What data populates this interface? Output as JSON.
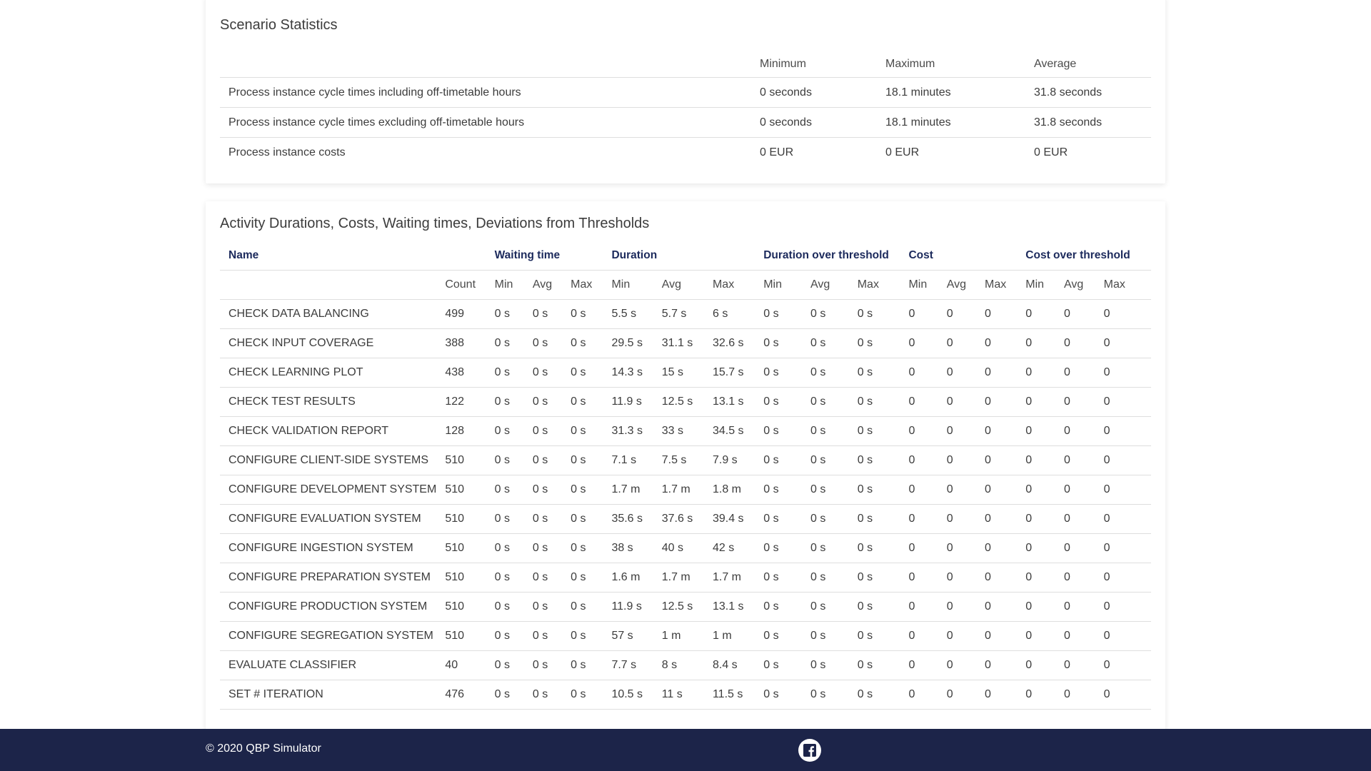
{
  "scenario": {
    "title": "Scenario Statistics",
    "columns": [
      "",
      "Minimum",
      "Maximum",
      "Average"
    ],
    "rows": [
      [
        "Process instance cycle times including off-timetable hours",
        "0 seconds",
        "18.1 minutes",
        "31.8 seconds"
      ],
      [
        "Process instance cycle times excluding off-timetable hours",
        "0 seconds",
        "18.1 minutes",
        "31.8 seconds"
      ],
      [
        "Process instance costs",
        "0 EUR",
        "0 EUR",
        "0 EUR"
      ]
    ]
  },
  "activity": {
    "title": "Activity Durations, Costs, Waiting times, Deviations from Thresholds",
    "groups": {
      "name": "Name",
      "waiting": "Waiting time",
      "duration": "Duration",
      "duration_over": "Duration over threshold",
      "cost": "Cost",
      "cost_over": "Cost over threshold"
    },
    "subheaders": [
      "",
      "Count",
      "Min",
      "Avg",
      "Max",
      "Min",
      "Avg",
      "Max",
      "Min",
      "Avg",
      "Max",
      "Min",
      "Avg",
      "Max",
      "Min",
      "Avg",
      "Max"
    ],
    "rows": [
      [
        "CHECK DATA BALANCING",
        "499",
        "0 s",
        "0 s",
        "0 s",
        "5.5 s",
        "5.7 s",
        "6 s",
        "0 s",
        "0 s",
        "0 s",
        "0",
        "0",
        "0",
        "0",
        "0",
        "0"
      ],
      [
        "CHECK INPUT COVERAGE",
        "388",
        "0 s",
        "0 s",
        "0 s",
        "29.5 s",
        "31.1 s",
        "32.6 s",
        "0 s",
        "0 s",
        "0 s",
        "0",
        "0",
        "0",
        "0",
        "0",
        "0"
      ],
      [
        "CHECK LEARNING PLOT",
        "438",
        "0 s",
        "0 s",
        "0 s",
        "14.3 s",
        "15 s",
        "15.7 s",
        "0 s",
        "0 s",
        "0 s",
        "0",
        "0",
        "0",
        "0",
        "0",
        "0"
      ],
      [
        "CHECK TEST RESULTS",
        "122",
        "0 s",
        "0 s",
        "0 s",
        "11.9 s",
        "12.5 s",
        "13.1 s",
        "0 s",
        "0 s",
        "0 s",
        "0",
        "0",
        "0",
        "0",
        "0",
        "0"
      ],
      [
        "CHECK VALIDATION REPORT",
        "128",
        "0 s",
        "0 s",
        "0 s",
        "31.3 s",
        "33 s",
        "34.5 s",
        "0 s",
        "0 s",
        "0 s",
        "0",
        "0",
        "0",
        "0",
        "0",
        "0"
      ],
      [
        "CONFIGURE CLIENT-SIDE SYSTEMS",
        "510",
        "0 s",
        "0 s",
        "0 s",
        "7.1 s",
        "7.5 s",
        "7.9 s",
        "0 s",
        "0 s",
        "0 s",
        "0",
        "0",
        "0",
        "0",
        "0",
        "0"
      ],
      [
        "CONFIGURE DEVELOPMENT SYSTEM",
        "510",
        "0 s",
        "0 s",
        "0 s",
        "1.7 m",
        "1.7 m",
        "1.8 m",
        "0 s",
        "0 s",
        "0 s",
        "0",
        "0",
        "0",
        "0",
        "0",
        "0"
      ],
      [
        "CONFIGURE EVALUATION SYSTEM",
        "510",
        "0 s",
        "0 s",
        "0 s",
        "35.6 s",
        "37.6 s",
        "39.4 s",
        "0 s",
        "0 s",
        "0 s",
        "0",
        "0",
        "0",
        "0",
        "0",
        "0"
      ],
      [
        "CONFIGURE INGESTION SYSTEM",
        "510",
        "0 s",
        "0 s",
        "0 s",
        "38 s",
        "40 s",
        "42 s",
        "0 s",
        "0 s",
        "0 s",
        "0",
        "0",
        "0",
        "0",
        "0",
        "0"
      ],
      [
        "CONFIGURE PREPARATION SYSTEM",
        "510",
        "0 s",
        "0 s",
        "0 s",
        "1.6 m",
        "1.7 m",
        "1.7 m",
        "0 s",
        "0 s",
        "0 s",
        "0",
        "0",
        "0",
        "0",
        "0",
        "0"
      ],
      [
        "CONFIGURE PRODUCTION SYSTEM",
        "510",
        "0 s",
        "0 s",
        "0 s",
        "11.9 s",
        "12.5 s",
        "13.1 s",
        "0 s",
        "0 s",
        "0 s",
        "0",
        "0",
        "0",
        "0",
        "0",
        "0"
      ],
      [
        "CONFIGURE SEGREGATION SYSTEM",
        "510",
        "0 s",
        "0 s",
        "0 s",
        "57 s",
        "1 m",
        "1 m",
        "0 s",
        "0 s",
        "0 s",
        "0",
        "0",
        "0",
        "0",
        "0",
        "0"
      ],
      [
        "EVALUATE CLASSIFIER",
        "40",
        "0 s",
        "0 s",
        "0 s",
        "7.7 s",
        "8 s",
        "8.4 s",
        "0 s",
        "0 s",
        "0 s",
        "0",
        "0",
        "0",
        "0",
        "0",
        "0"
      ],
      [
        "SET # ITERATION",
        "476",
        "0 s",
        "0 s",
        "0 s",
        "10.5 s",
        "11 s",
        "11.5 s",
        "0 s",
        "0 s",
        "0 s",
        "0",
        "0",
        "0",
        "0",
        "0",
        "0"
      ]
    ]
  },
  "footer": {
    "copyright": "© 2020 QBP Simulator",
    "social_icon": "facebook-icon"
  }
}
